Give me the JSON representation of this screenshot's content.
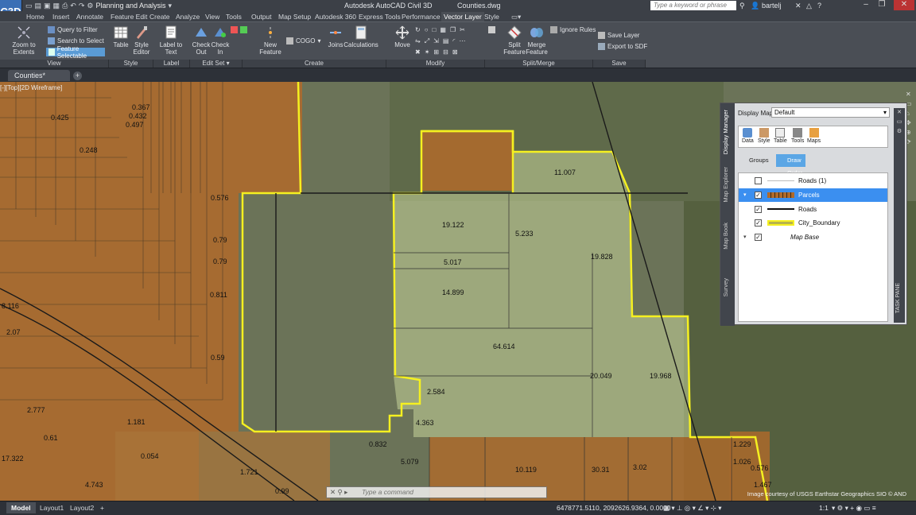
{
  "window": {
    "app_title": "Autodesk AutoCAD Civil 3D",
    "document_title": "Counties.dwg",
    "workspace": "Planning and Analysis",
    "search_placeholder": "Type a keyword or phrase",
    "user": "bartelj",
    "app_icon_label": "C3D"
  },
  "ribbon_tabs": [
    "Home",
    "Insert",
    "Annotate",
    "Feature Edit",
    "Create",
    "Analyze",
    "View",
    "Tools",
    "Output",
    "Map Setup",
    "Autodesk 360",
    "Express Tools",
    "Performance",
    "Vector Layer",
    "Style"
  ],
  "active_tab": "Vector Layer",
  "ribbon": {
    "view": {
      "zoom_to_extents": "Zoom to Extents",
      "query_to_filter": "Query to Filter",
      "search_to_select": "Search to Select",
      "feature_selectable": "Feature Selectable",
      "group": "View"
    },
    "style": {
      "table": "Table",
      "style_editor_1": "Style",
      "style_editor_2": "Editor",
      "group": "Style"
    },
    "label": {
      "label_to_text_1": "Label to",
      "label_to_text_2": "Text",
      "group": "Label Feature"
    },
    "edit_set": {
      "check_out_1": "Check",
      "check_out_2": "Out",
      "check_in_1": "Check",
      "check_in_2": "In",
      "group": "Edit Set"
    },
    "create": {
      "new_feature_1": "New",
      "new_feature_2": "Feature",
      "cogo": "COGO",
      "joins": "Joins",
      "calculations": "Calculations",
      "group": "Create"
    },
    "modify": {
      "move": "Move",
      "group": "Modify"
    },
    "split_merge": {
      "split_1": "Split",
      "split_2": "Feature",
      "merge_1": "Merge",
      "merge_2": "Feature",
      "ignore_rules": "Ignore Rules",
      "group": "Split/Merge"
    },
    "save": {
      "save_layer": "Save Layer",
      "export_to_sdf": "Export to SDF",
      "group": "Save"
    }
  },
  "doc_tab": "Counties*",
  "viewport_label": "[-][Top][2D Wireframe]",
  "parcel_labels": [
    {
      "t": "0.425"
    },
    {
      "t": "0.367"
    },
    {
      "t": "0.432"
    },
    {
      "t": "0.497"
    },
    {
      "t": "0.248"
    },
    {
      "t": "0.576"
    },
    {
      "t": "0.79"
    },
    {
      "t": "0.79"
    },
    {
      "t": "0.811"
    },
    {
      "t": "0.59"
    },
    {
      "t": "8.116"
    },
    {
      "t": "2.07"
    },
    {
      "t": "2.777"
    },
    {
      "t": "1.181"
    },
    {
      "t": "0.61"
    },
    {
      "t": "17.322"
    },
    {
      "t": "0.054"
    },
    {
      "t": "1.721"
    },
    {
      "t": "4.743"
    },
    {
      "t": "0.99"
    },
    {
      "t": "0.832"
    },
    {
      "t": "5.079"
    },
    {
      "t": "10.119"
    },
    {
      "t": "30.31"
    },
    {
      "t": "3.02"
    },
    {
      "t": "1.229"
    },
    {
      "t": "1.026"
    },
    {
      "t": "0.576"
    },
    {
      "t": "1.467"
    },
    {
      "t": "11.007"
    },
    {
      "t": "19.122"
    },
    {
      "t": "5.233"
    },
    {
      "t": "5.017"
    },
    {
      "t": "19.828"
    },
    {
      "t": "14.899"
    },
    {
      "t": "64.614"
    },
    {
      "t": "20.049"
    },
    {
      "t": "19.968"
    },
    {
      "t": "2.584"
    },
    {
      "t": "4.363"
    }
  ],
  "display_manager": {
    "title": "Display Manager",
    "side_tabs": [
      "Display Manager",
      "Map Explorer",
      "Map Book",
      "Survey"
    ],
    "display_map_label": "Display Map:",
    "display_map_value": "Default",
    "tools": [
      "Data",
      "Style",
      "Table",
      "Tools",
      "Maps"
    ],
    "groups_tab": "Groups",
    "draw_order_tab": "Draw Order",
    "layers": [
      {
        "name": "Roads (1)",
        "checked": false
      },
      {
        "name": "Parcels",
        "checked": true
      },
      {
        "name": "Roads",
        "checked": true
      },
      {
        "name": "City_Boundary",
        "checked": true
      },
      {
        "name": "Map Base",
        "checked": true
      }
    ],
    "task_pane": "TASK PANE"
  },
  "layout_tabs": [
    "Model",
    "Layout1",
    "Layout2"
  ],
  "command_prompt": "Type a command",
  "coordinates": "6478771.5110, 2092626.9364, 0.0000",
  "scale": "1:1",
  "copyright": "Image courtesy of USGS Earthstar Geographics SIO © AND",
  "colors": {
    "accent": "#5ba6e5",
    "parcel_fill": "#b86a22",
    "city_boundary": "#f5f020"
  }
}
